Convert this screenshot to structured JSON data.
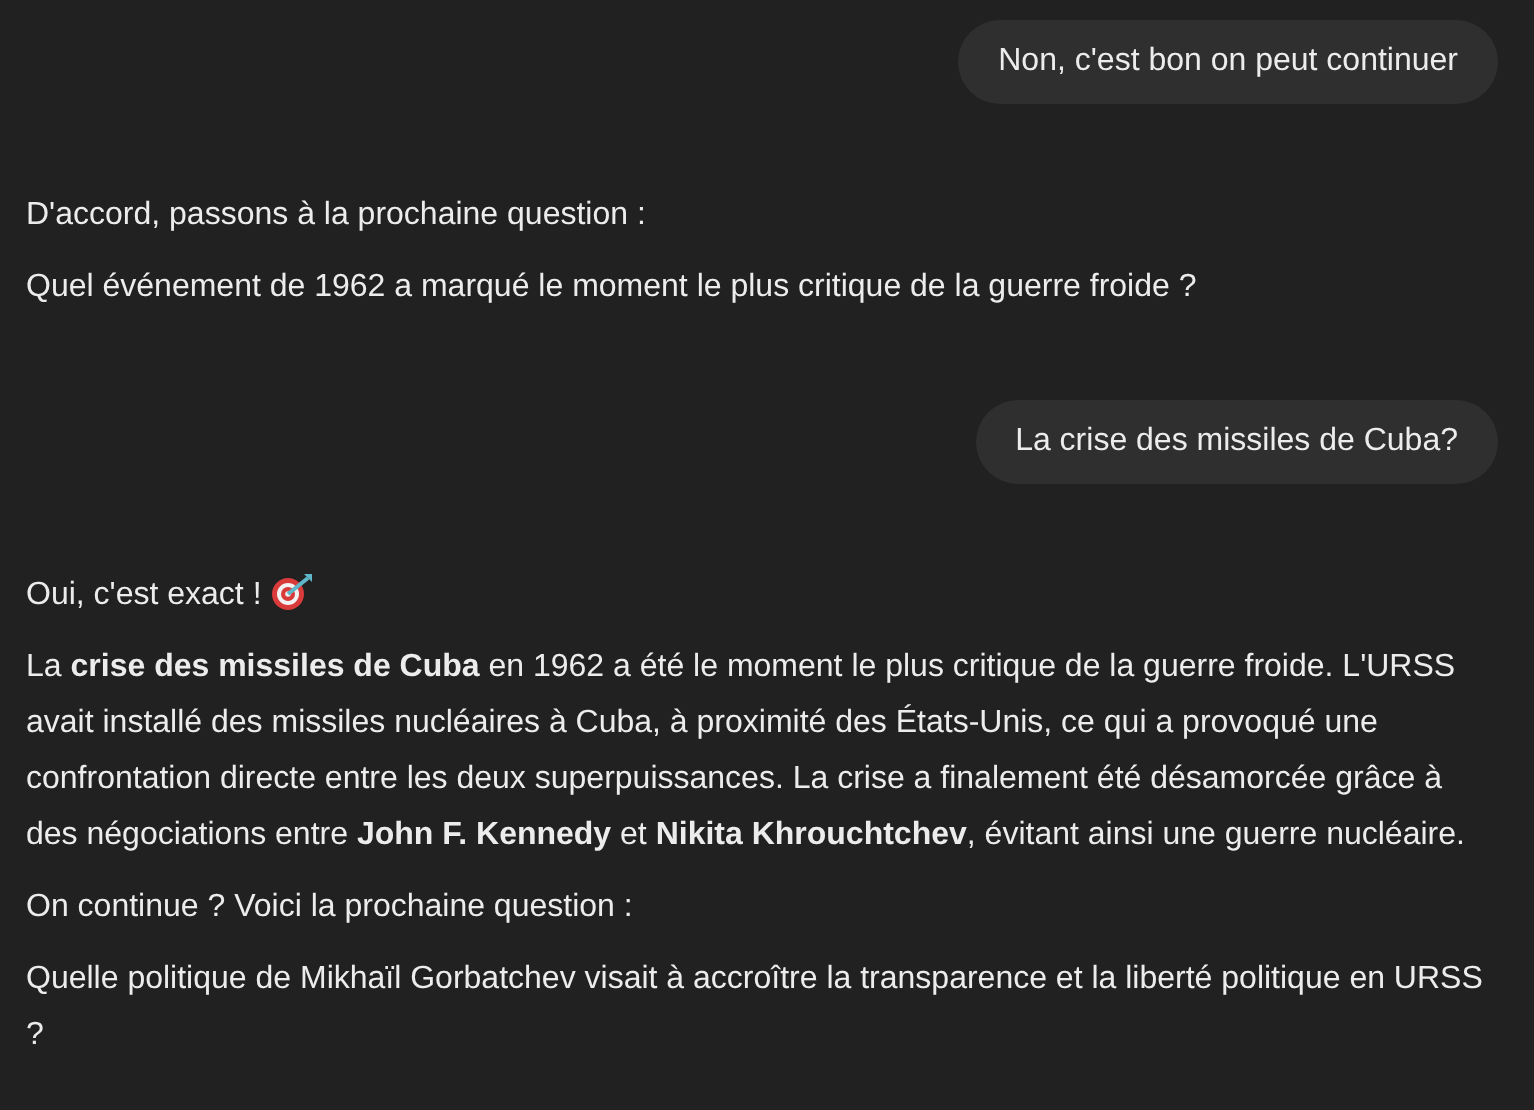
{
  "messages": [
    {
      "kind": "user",
      "paragraphs": [
        {
          "text": "Non, c'est bon on peut continuer"
        }
      ]
    },
    {
      "kind": "assistant",
      "paragraphs": [
        {
          "text": "D'accord, passons à la prochaine question :"
        },
        {
          "text": "Quel événement de 1962 a marqué le moment le plus critique de la guerre froide ?"
        }
      ]
    },
    {
      "kind": "user",
      "paragraphs": [
        {
          "text": "La crise des missiles de Cuba?"
        }
      ]
    },
    {
      "kind": "assistant",
      "paragraphs": [
        {
          "text": "Oui, c'est exact !",
          "emoji": true
        },
        {
          "text": "La **crise des missiles de Cuba** en 1962 a été le moment le plus critique de la guerre froide. L'URSS avait installé des missiles nucléaires à Cuba, à proximité des États-Unis, ce qui a provoqué une confrontation directe entre les deux superpuissances. La crise a finalement été désamorcée grâce à des négociations entre **John F. Kennedy** et **Nikita Khrouchtchev**, évitant ainsi une guerre nucléaire."
        },
        {
          "text": "On continue ? Voici la prochaine question :"
        },
        {
          "text": "Quelle politique de Mikhaïl Gorbatchev visait à accroître la transparence et la liberté politique en URSS ?"
        }
      ]
    }
  ]
}
